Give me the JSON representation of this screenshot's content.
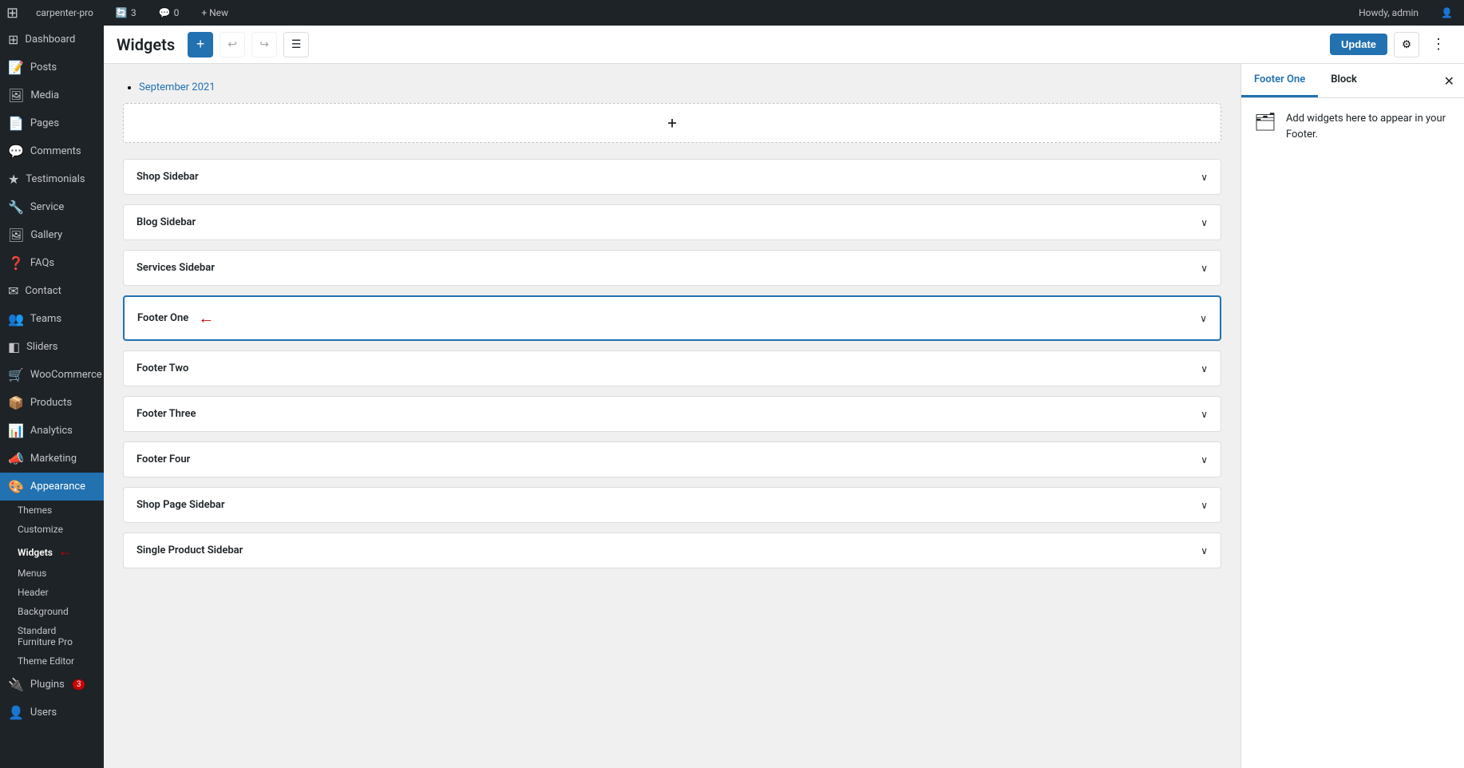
{
  "adminBar": {
    "wpLogo": "⊞",
    "siteName": "carpenter-pro",
    "updates": "3",
    "comments": "0",
    "newLabel": "+ New",
    "howdy": "Howdy, admin"
  },
  "sidebar": {
    "items": [
      {
        "id": "dashboard",
        "label": "Dashboard",
        "icon": "⊞"
      },
      {
        "id": "posts",
        "label": "Posts",
        "icon": "📝"
      },
      {
        "id": "media",
        "label": "Media",
        "icon": "🖼"
      },
      {
        "id": "pages",
        "label": "Pages",
        "icon": "📄"
      },
      {
        "id": "comments",
        "label": "Comments",
        "icon": "💬"
      },
      {
        "id": "testimonials",
        "label": "Testimonials",
        "icon": "★"
      },
      {
        "id": "service",
        "label": "Service",
        "icon": "🔧"
      },
      {
        "id": "gallery",
        "label": "Gallery",
        "icon": "🖼"
      },
      {
        "id": "faqs",
        "label": "FAQs",
        "icon": "❓"
      },
      {
        "id": "contact",
        "label": "Contact",
        "icon": "✉"
      },
      {
        "id": "teams",
        "label": "Teams",
        "icon": "👥"
      },
      {
        "id": "sliders",
        "label": "Sliders",
        "icon": "◧"
      },
      {
        "id": "woocommerce",
        "label": "WooCommerce",
        "icon": "🛒"
      },
      {
        "id": "products",
        "label": "Products",
        "icon": "📦"
      },
      {
        "id": "analytics",
        "label": "Analytics",
        "icon": "📊"
      },
      {
        "id": "marketing",
        "label": "Marketing",
        "icon": "📣"
      },
      {
        "id": "appearance",
        "label": "Appearance",
        "icon": "🎨",
        "active": true
      },
      {
        "id": "plugins",
        "label": "Plugins",
        "icon": "🔌",
        "badge": "3"
      },
      {
        "id": "users",
        "label": "Users",
        "icon": "👤"
      }
    ],
    "appearanceSubItems": [
      {
        "id": "themes",
        "label": "Themes"
      },
      {
        "id": "customize",
        "label": "Customize"
      },
      {
        "id": "widgets",
        "label": "Widgets",
        "active": true
      },
      {
        "id": "menus",
        "label": "Menus"
      },
      {
        "id": "header",
        "label": "Header"
      },
      {
        "id": "background",
        "label": "Background"
      },
      {
        "id": "standard-furniture-pro",
        "label": "Standard Furniture Pro"
      },
      {
        "id": "theme-editor",
        "label": "Theme Editor"
      }
    ]
  },
  "toolbar": {
    "title": "Widgets",
    "addLabel": "+",
    "updateLabel": "Update"
  },
  "archive": {
    "link": "September 2021"
  },
  "widgetSections": [
    {
      "id": "shop-sidebar",
      "label": "Shop Sidebar",
      "active": false
    },
    {
      "id": "blog-sidebar",
      "label": "Blog Sidebar",
      "active": false
    },
    {
      "id": "services-sidebar",
      "label": "Services Sidebar",
      "active": false
    },
    {
      "id": "footer-one",
      "label": "Footer One",
      "active": true
    },
    {
      "id": "footer-two",
      "label": "Footer Two",
      "active": false
    },
    {
      "id": "footer-three",
      "label": "Footer Three",
      "active": false
    },
    {
      "id": "footer-four",
      "label": "Footer Four",
      "active": false
    },
    {
      "id": "shop-page-sidebar",
      "label": "Shop Page Sidebar",
      "active": false
    },
    {
      "id": "single-product-sidebar",
      "label": "Single Product Sidebar",
      "active": false
    }
  ],
  "rightPanel": {
    "tabs": [
      {
        "id": "footer-one",
        "label": "Footer One",
        "active": true
      },
      {
        "id": "block",
        "label": "Block",
        "active": false
      }
    ],
    "description": "Add widgets here to appear in your Footer."
  }
}
